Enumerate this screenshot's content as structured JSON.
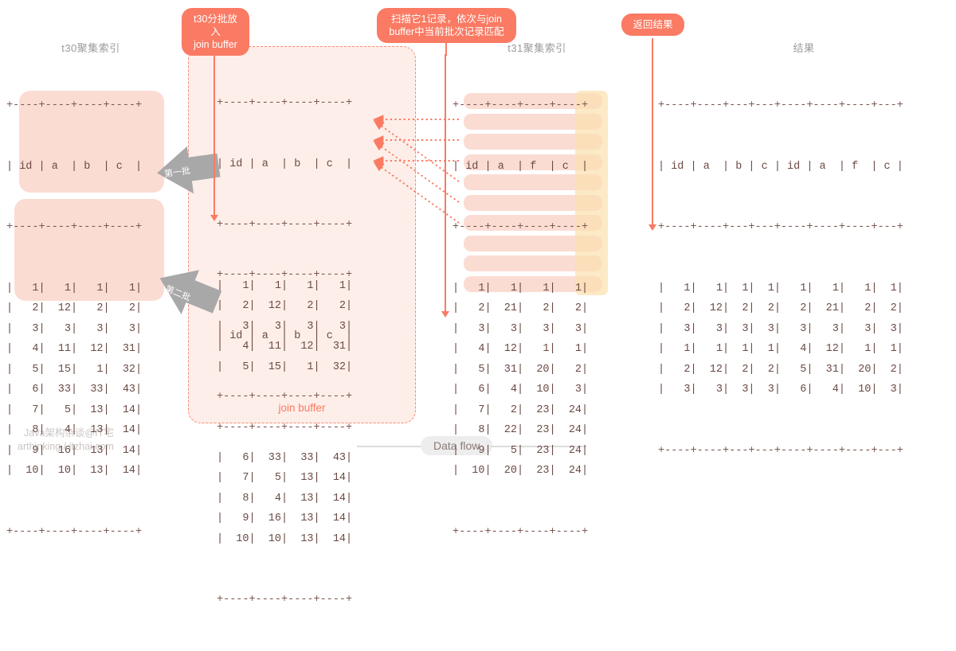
{
  "callouts": {
    "left": {
      "line1": "t30分批放入",
      "line2": "join buffer"
    },
    "middle": {
      "line1": "扫描它1记录，依次与join",
      "line2": "buffer中当前批次记录匹配"
    },
    "right": {
      "line1": "返回结果",
      "line2": ""
    }
  },
  "batch_arrows": {
    "first": "第一批",
    "second": "第二批"
  },
  "join_buffer": {
    "label": "join buffer"
  },
  "tables": {
    "t30": {
      "title": "t30聚集索引",
      "columns": [
        "id",
        "a",
        "b",
        "c"
      ],
      "rows": [
        [
          "1",
          "1",
          "1",
          "1"
        ],
        [
          "2",
          "12",
          "2",
          "2"
        ],
        [
          "3",
          "3",
          "3",
          "3"
        ],
        [
          "4",
          "11",
          "12",
          "31"
        ],
        [
          "5",
          "15",
          "1",
          "32"
        ],
        [
          "6",
          "33",
          "33",
          "43"
        ],
        [
          "7",
          "5",
          "13",
          "14"
        ],
        [
          "8",
          "4",
          "13",
          "14"
        ],
        [
          "9",
          "16",
          "13",
          "14"
        ],
        [
          "10",
          "10",
          "13",
          "14"
        ]
      ]
    },
    "jb_batch1": {
      "columns": [
        "id",
        "a",
        "b",
        "c"
      ],
      "rows": [
        [
          "1",
          "1",
          "1",
          "1"
        ],
        [
          "2",
          "12",
          "2",
          "2"
        ],
        [
          "3",
          "3",
          "3",
          "3"
        ],
        [
          "4",
          "11",
          "12",
          "31"
        ],
        [
          "5",
          "15",
          "1",
          "32"
        ]
      ]
    },
    "jb_batch2": {
      "columns": [
        "id",
        "a",
        "b",
        "c"
      ],
      "rows": [
        [
          "6",
          "33",
          "33",
          "43"
        ],
        [
          "7",
          "5",
          "13",
          "14"
        ],
        [
          "8",
          "4",
          "13",
          "14"
        ],
        [
          "9",
          "16",
          "13",
          "14"
        ],
        [
          "10",
          "10",
          "13",
          "14"
        ]
      ]
    },
    "t31": {
      "title": "t31聚集索引",
      "columns": [
        "id",
        "a",
        "f",
        "c"
      ],
      "rows": [
        [
          "1",
          "1",
          "1",
          "1"
        ],
        [
          "2",
          "21",
          "2",
          "2"
        ],
        [
          "3",
          "3",
          "3",
          "3"
        ],
        [
          "4",
          "12",
          "1",
          "1"
        ],
        [
          "5",
          "31",
          "20",
          "2"
        ],
        [
          "6",
          "4",
          "10",
          "3"
        ],
        [
          "7",
          "2",
          "23",
          "24"
        ],
        [
          "8",
          "22",
          "23",
          "24"
        ],
        [
          "9",
          "5",
          "23",
          "24"
        ],
        [
          "10",
          "20",
          "23",
          "24"
        ]
      ]
    },
    "result": {
      "title": "结果",
      "columns": [
        "id",
        "a",
        "b",
        "c",
        "id",
        "a",
        "f",
        "c"
      ],
      "rows": [
        [
          "1",
          "1",
          "1",
          "1",
          "1",
          "1",
          "1",
          "1"
        ],
        [
          "2",
          "12",
          "2",
          "2",
          "2",
          "21",
          "2",
          "2"
        ],
        [
          "3",
          "3",
          "3",
          "3",
          "3",
          "3",
          "3",
          "3"
        ],
        [
          "1",
          "1",
          "1",
          "1",
          "4",
          "12",
          "1",
          "1"
        ],
        [
          "2",
          "12",
          "2",
          "2",
          "5",
          "31",
          "20",
          "2"
        ],
        [
          "3",
          "3",
          "3",
          "3",
          "6",
          "4",
          "10",
          "3"
        ]
      ]
    }
  },
  "footer": {
    "brand": "Java架构杂谈@IT宅",
    "site": "arthinking / itzhai.com",
    "dataflow": "Data flow"
  },
  "colors": {
    "accent": "#fa7a63",
    "row_highlight": "#fbdcd3",
    "col_highlight": "#fbe0b0",
    "buffer_bg": "#fdeee9",
    "text": "#6b4a44",
    "muted": "#9b9b9b"
  }
}
